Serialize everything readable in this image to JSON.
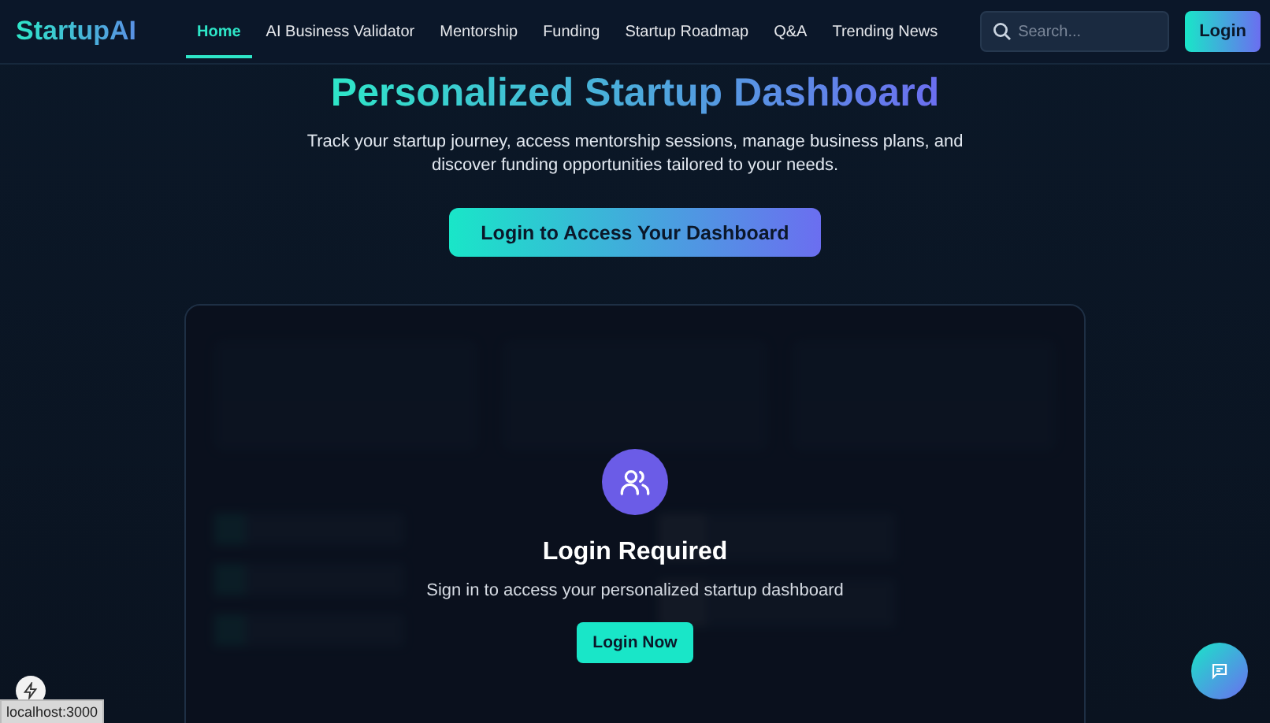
{
  "brand": "StartupAI",
  "nav": [
    {
      "label": "Home",
      "selected": true
    },
    {
      "label": "AI Business Validator",
      "selected": false
    },
    {
      "label": "Mentorship",
      "selected": false
    },
    {
      "label": "Funding",
      "selected": false
    },
    {
      "label": "Startup Roadmap",
      "selected": false
    },
    {
      "label": "Q&A",
      "selected": false
    },
    {
      "label": "Trending News",
      "selected": false
    }
  ],
  "search": {
    "placeholder": "Search..."
  },
  "login_button": "Login",
  "hero": {
    "title": "Personalized Startup Dashboard",
    "subtitle": "Track your startup journey, access mentorship sessions, manage business plans, and discover funding opportunities tailored to your needs.",
    "cta": "Login to Access Your Dashboard"
  },
  "overlay": {
    "title": "Login Required",
    "message": "Sign in to access your personalized startup dashboard",
    "button": "Login Now"
  },
  "status_url": "localhost:3000"
}
